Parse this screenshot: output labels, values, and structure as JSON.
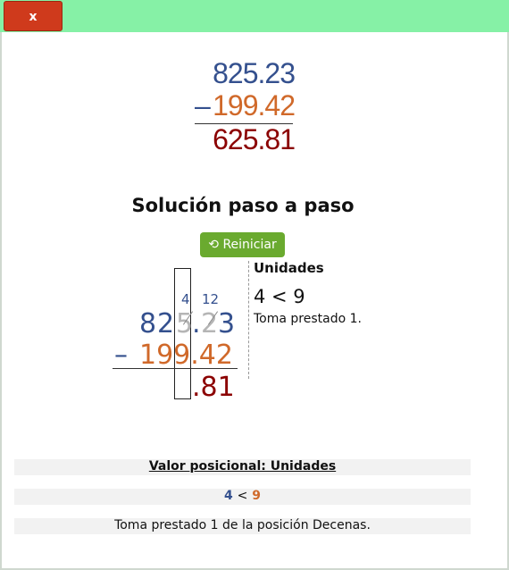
{
  "window": {
    "close_label": "x"
  },
  "problem": {
    "minuend": "825.23",
    "subtrahend": "199.42",
    "operator": "–",
    "result": "625.81"
  },
  "solution": {
    "heading": "Solución paso a paso",
    "reset_label": "Reiniciar",
    "reset_icon": "refresh-icon"
  },
  "step": {
    "borrow_top_left": "4",
    "borrow_top_right": "12",
    "minuend_chars": [
      "8",
      "2",
      "5",
      ".",
      "2",
      "3"
    ],
    "subtrahend": "199.42",
    "operator": "–",
    "partial_result": ".81",
    "place_title": "Unidades",
    "compare_text": "4 < 9",
    "note": "Toma prestado 1."
  },
  "explanation": {
    "title": "Valor posicional: Unidades",
    "cmp_left": "4",
    "cmp_op": "<",
    "cmp_right": "9",
    "text": "Toma prestado 1 de la posición Decenas."
  },
  "colors": {
    "header_bar": "#86f1a6",
    "close_button": "#cf3a1c",
    "reset_button": "#6aaa2f",
    "minuend": "#34508e",
    "subtrahend": "#d0692a",
    "result": "#8b0000"
  }
}
